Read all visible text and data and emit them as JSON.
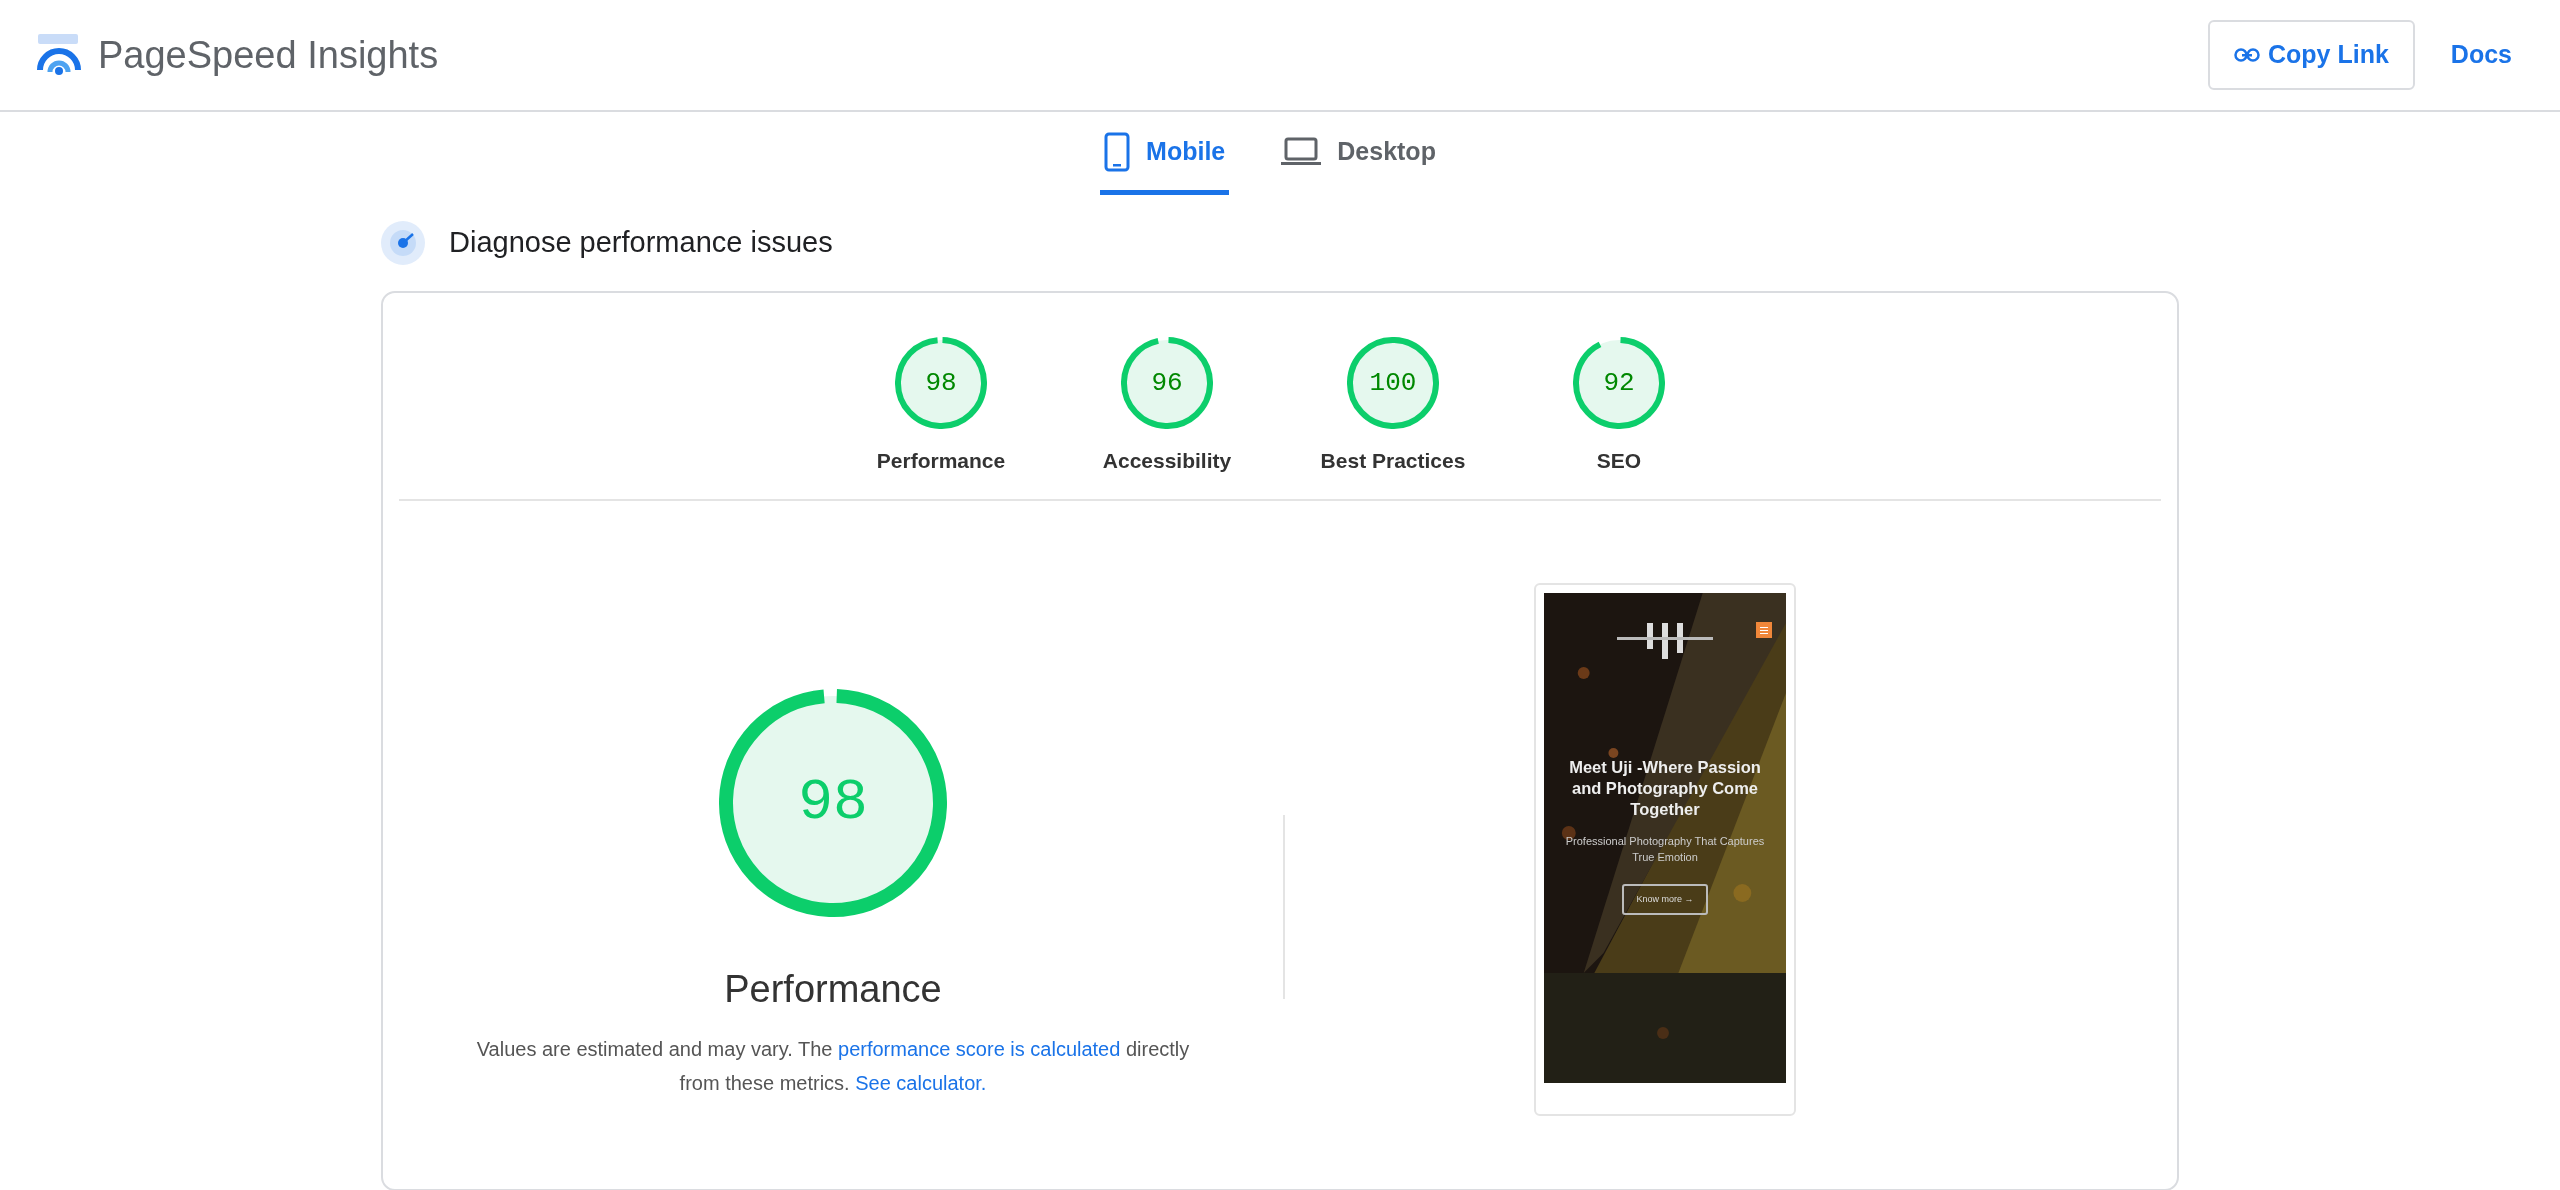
{
  "header": {
    "title": "PageSpeed Insights",
    "actions": [
      {
        "kind": "button",
        "label": "Copy Link"
      },
      {
        "kind": "link",
        "label": "Docs"
      }
    ]
  },
  "device_tabs": [
    {
      "label": "Mobile",
      "kind": "phone",
      "selected": true
    },
    {
      "label": "Desktop",
      "kind": "laptop",
      "selected": false
    }
  ],
  "section_title": "Diagnose performance issues",
  "categories": [
    {
      "label": "Performance",
      "score": "98",
      "level": 0.98
    },
    {
      "label": "Accessibility",
      "score": "96",
      "level": 0.96
    },
    {
      "label": "Best Practices",
      "score": "100",
      "level": 1
    },
    {
      "label": "SEO",
      "score": "92",
      "level": 0.92
    }
  ],
  "performance": {
    "score": "98",
    "level": 0.98,
    "title": "Performance",
    "description": [
      {
        "kind": "text",
        "text": "Values are estimated and may vary. The "
      },
      {
        "kind": "link",
        "text": "performance score is calculated"
      },
      {
        "kind": "text",
        "text": " directly from these metrics. "
      },
      {
        "kind": "link",
        "text": "See calculator."
      }
    ]
  },
  "preview": {
    "headline": "Meet Uji -Where Passion and Photography Come Together",
    "subtitle": "Professional Photography That Captures True Emotion",
    "button": "Know more →"
  }
}
